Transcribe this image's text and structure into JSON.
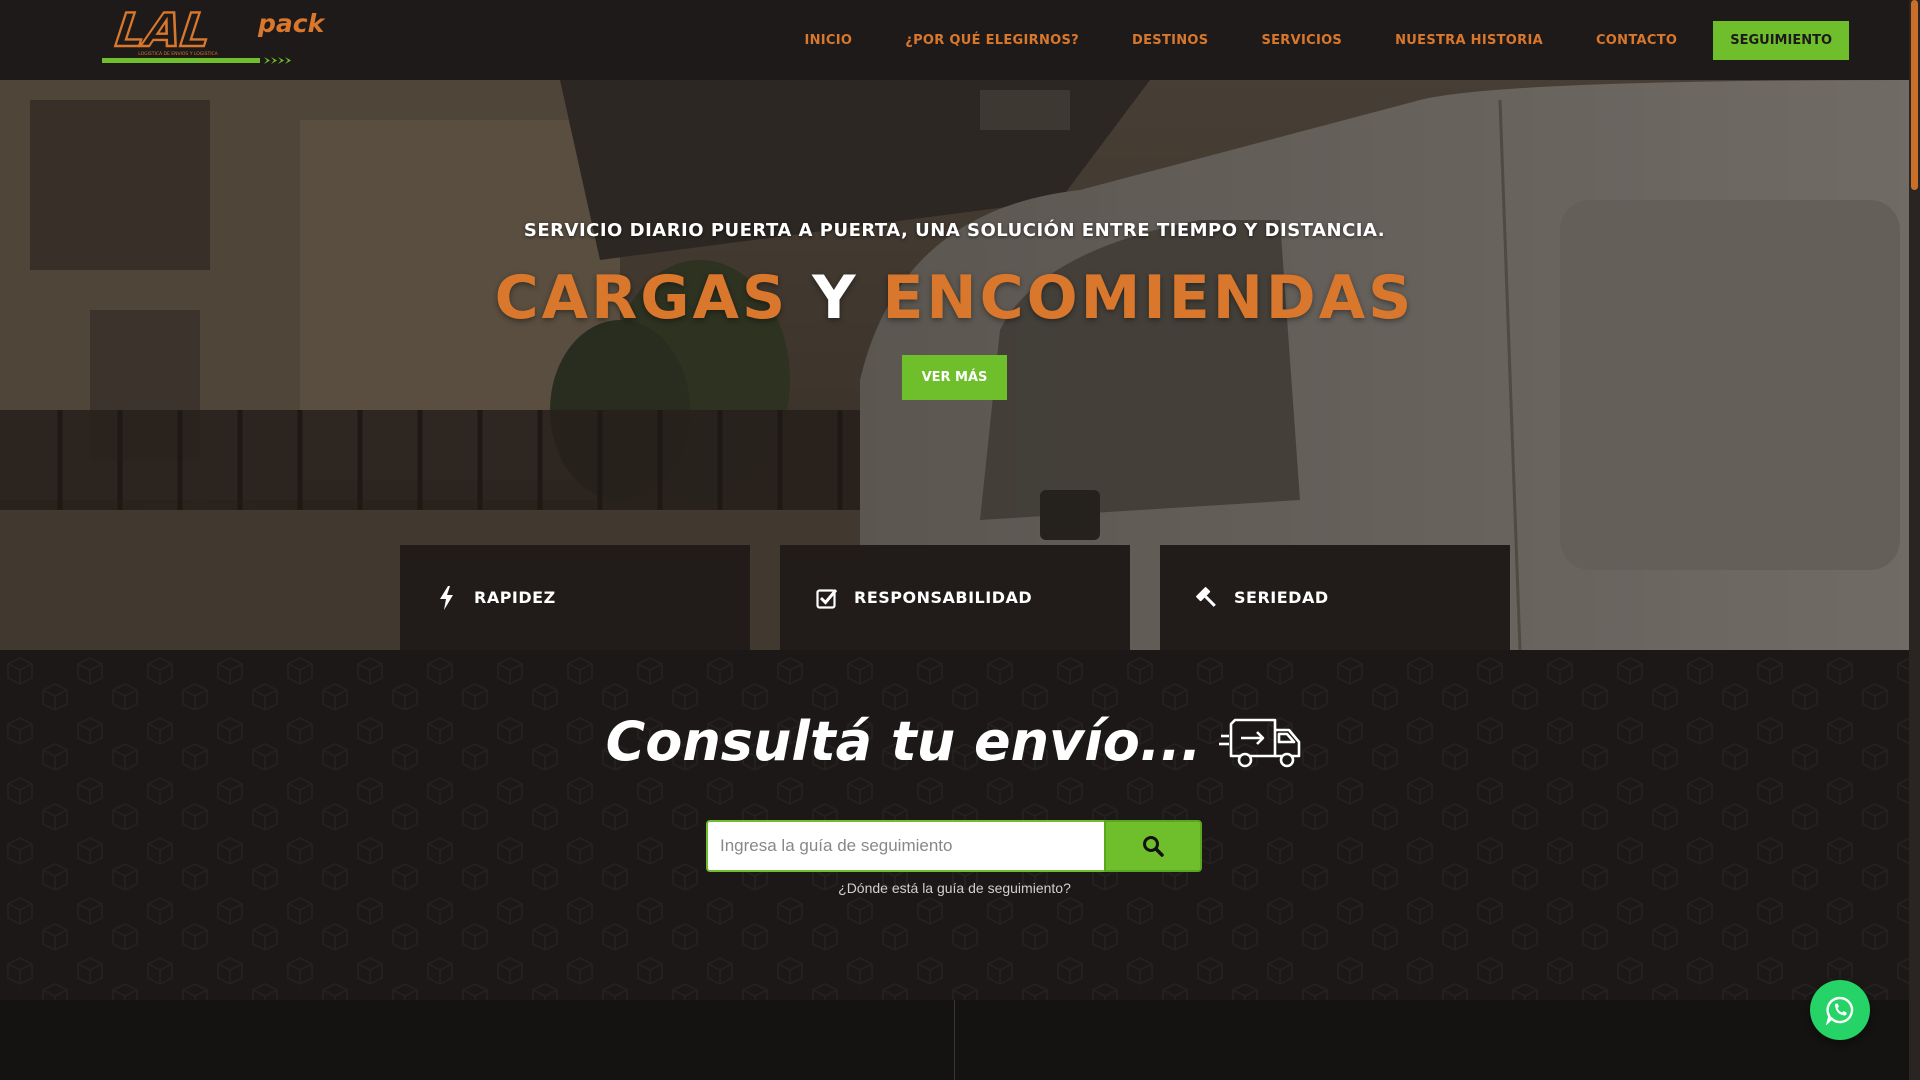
{
  "brand": {
    "logo_text_main": "LAL",
    "logo_text_sub": "pack",
    "logo_tagline": "LOGISTICA DE ENVIOS Y LOGISTICA"
  },
  "nav": {
    "items": [
      "INICIO",
      "¿POR QUÉ ELEGIRNOS?",
      "DESTINOS",
      "SERVICIOS",
      "NUESTRA HISTORIA",
      "CONTACTO"
    ],
    "cta": "SEGUIMIENTO"
  },
  "hero": {
    "subtitle": "SERVICIO DIARIO PUERTA A PUERTA, UNA SOLUCIÓN ENTRE TIEMPO Y DISTANCIA.",
    "title_part1": "CARGAS",
    "title_part2": "Y",
    "title_part3": "ENCOMIENDAS",
    "button": "VER MÁS"
  },
  "features": [
    {
      "icon": "bolt-icon",
      "label": "RAPIDEZ"
    },
    {
      "icon": "check-square-icon",
      "label": "RESPONSABILIDAD"
    },
    {
      "icon": "gavel-icon",
      "label": "SERIEDAD"
    }
  ],
  "tracking": {
    "title": "Consultá tu envío...",
    "input_placeholder": "Ingresa la guía de seguimiento",
    "help_link": "¿Dónde está la guía de seguimiento?"
  },
  "colors": {
    "accent_orange": "#d9782d",
    "accent_green": "#6fbe2c",
    "header_bg": "#1e1a19",
    "whatsapp": "#25d366"
  }
}
